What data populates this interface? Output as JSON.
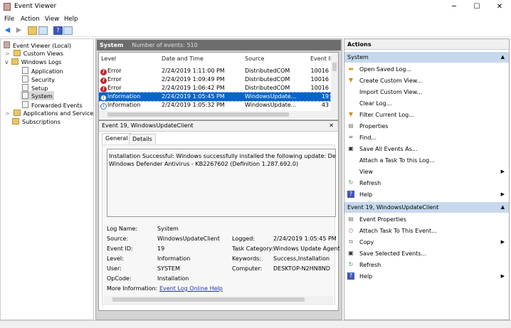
{
  "window": {
    "title": "Event Viewer",
    "minimize": "─",
    "maximize": "☐",
    "close": "✕"
  },
  "menu": [
    "File",
    "Action",
    "View",
    "Help"
  ],
  "tree": [
    {
      "label": "Event Viewer (Local)",
      "level": 0
    },
    {
      "label": "Custom Views",
      "level": 1,
      "expander": ">"
    },
    {
      "label": "Windows Logs",
      "level": 1,
      "expander": "v"
    },
    {
      "label": "Application",
      "level": 2
    },
    {
      "label": "Security",
      "level": 2
    },
    {
      "label": "Setup",
      "level": 2
    },
    {
      "label": "System",
      "level": 2,
      "selected": true
    },
    {
      "label": "Forwarded Events",
      "level": 2
    },
    {
      "label": "Applications and Services Lo",
      "level": 1,
      "expander": ">"
    },
    {
      "label": "Subscriptions",
      "level": 1
    }
  ],
  "log": {
    "name": "System",
    "count_label": "Number of events: 510",
    "columns": [
      "Level",
      "Date and Time",
      "Source",
      "Event ID"
    ],
    "rows": [
      {
        "level": "Error",
        "date": "2/24/2019 1:11:00 PM",
        "source": "DistributedCOM",
        "id": "10016"
      },
      {
        "level": "Error",
        "date": "2/24/2019 1:09:49 PM",
        "source": "DistributedCOM",
        "id": "10016"
      },
      {
        "level": "Error",
        "date": "2/24/2019 1:06:42 PM",
        "source": "DistributedCOM",
        "id": "10016"
      },
      {
        "level": "Information",
        "date": "2/24/2019 1:05:45 PM",
        "source": "WindowsUpdate...",
        "id": "19",
        "selected": true
      },
      {
        "level": "Information",
        "date": "2/24/2019 1:05:32 PM",
        "source": "WindowsUpdate...",
        "id": "43"
      }
    ]
  },
  "detail": {
    "title": "Event 19, WindowsUpdateClient",
    "close": "✕",
    "tabs": [
      "General",
      "Details"
    ],
    "message_line1": "Installation Successful: Windows successfully installed the following update: Definition Upd",
    "message_line2": "Windows Defender Antivirus - KB2267602 (Definition 1.287.692.0)",
    "fields": {
      "log_name_label": "Log Name:",
      "log_name": "System",
      "source_label": "Source:",
      "source": "WindowsUpdateClient",
      "event_id_label": "Event ID:",
      "event_id": "19",
      "level_label": "Level:",
      "level": "Information",
      "user_label": "User:",
      "user": "SYSTEM",
      "opcode_label": "OpCode:",
      "opcode": "Installation",
      "more_info_label": "More Information:",
      "more_info_link": "Event Log Online Help",
      "logged_label": "Logged:",
      "logged": "2/24/2019 1:05:45 PM",
      "task_label": "Task Category:",
      "task": "Windows Update Agent",
      "keywords_label": "Keywords:",
      "keywords": "Success,Installation",
      "computer_label": "Computer:",
      "computer": "DESKTOP-N2HN8ND"
    }
  },
  "actions": {
    "title": "Actions",
    "system_section": "System",
    "system_items": [
      {
        "label": "Open Saved Log...",
        "icon": "open-folder-icon"
      },
      {
        "label": "Create Custom View...",
        "icon": "filter-icon"
      },
      {
        "label": "Import Custom View...",
        "icon": ""
      },
      {
        "label": "Clear Log...",
        "icon": ""
      },
      {
        "label": "Filter Current Log...",
        "icon": "filter-icon"
      },
      {
        "label": "Properties",
        "icon": "properties-icon"
      },
      {
        "label": "Find...",
        "icon": "binoculars-icon"
      },
      {
        "label": "Save All Events As...",
        "icon": "save-icon"
      },
      {
        "label": "Attach a Task To this Log...",
        "icon": ""
      },
      {
        "label": "View",
        "icon": "",
        "submenu": true
      },
      {
        "label": "Refresh",
        "icon": "refresh-icon"
      },
      {
        "label": "Help",
        "icon": "help-icon",
        "submenu": true
      }
    ],
    "event_section": "Event 19, WindowsUpdateClient",
    "event_items": [
      {
        "label": "Event Properties",
        "icon": "properties-icon"
      },
      {
        "label": "Attach Task To This Event...",
        "icon": "task-icon"
      },
      {
        "label": "Copy",
        "icon": "copy-icon",
        "submenu": true
      },
      {
        "label": "Save Selected Events...",
        "icon": "save-icon"
      },
      {
        "label": "Refresh",
        "icon": "refresh-icon"
      },
      {
        "label": "Help",
        "icon": "help-icon",
        "submenu": true
      }
    ]
  },
  "colors": {
    "selection": "#0a64c8",
    "section_header": "#c6d9ec",
    "log_header": "#6d6d6d",
    "error": "#c4262e",
    "link": "#1b34b8"
  }
}
